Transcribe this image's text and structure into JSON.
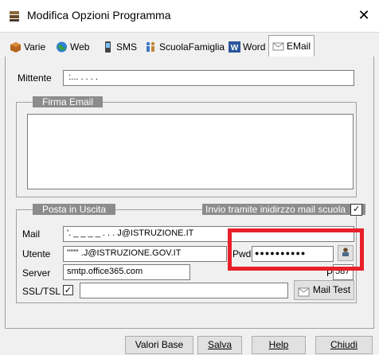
{
  "window": {
    "title": "Modifica Opzioni Programma",
    "close_glyph": "✕"
  },
  "tabs": [
    {
      "label": "Varie",
      "icon": "box-icon"
    },
    {
      "label": "Web",
      "icon": "globe-icon"
    },
    {
      "label": "SMS",
      "icon": "phone-icon"
    },
    {
      "label": "ScuolaFamiglia",
      "icon": "family-icon"
    },
    {
      "label": "Word",
      "icon": "word-icon"
    },
    {
      "label": "EMail",
      "icon": "mail-icon",
      "active": true
    }
  ],
  "mittente": {
    "label": "Mittente",
    "value": " :...  .  . . . "
  },
  "firma": {
    "title": "Firma Email",
    "value": ""
  },
  "posta": {
    "title": "Posta in Uscita",
    "invio_label": "Invio tramite inidirzzo mail scuola",
    "invio_checked": true,
    "mail_label": "Mail",
    "mail_value": "'. _ _ _ _ . . . J@ISTRUZIONE.IT",
    "utente_label": "Utente",
    "utente_value": "'''''''      .J@ISTRUZIONE.GOV.IT",
    "pwd_label": "Pwd",
    "pwd_value": "●●●●●●●●●●",
    "server_label": "Server",
    "server_value": "smtp.office365.com",
    "porta_label": "Porta",
    "porta_value": "587",
    "ssl_label": "SSL/TSL",
    "ssl_checked": true,
    "mailtest_label": "Mail Test"
  },
  "buttons": {
    "valori_base": "Valori Base",
    "salva": "Salva",
    "help": "Help",
    "chiudi": "Chiudi"
  },
  "colors": {
    "highlight": "#e8202a",
    "group_title_bg": "#8c8c8c"
  }
}
